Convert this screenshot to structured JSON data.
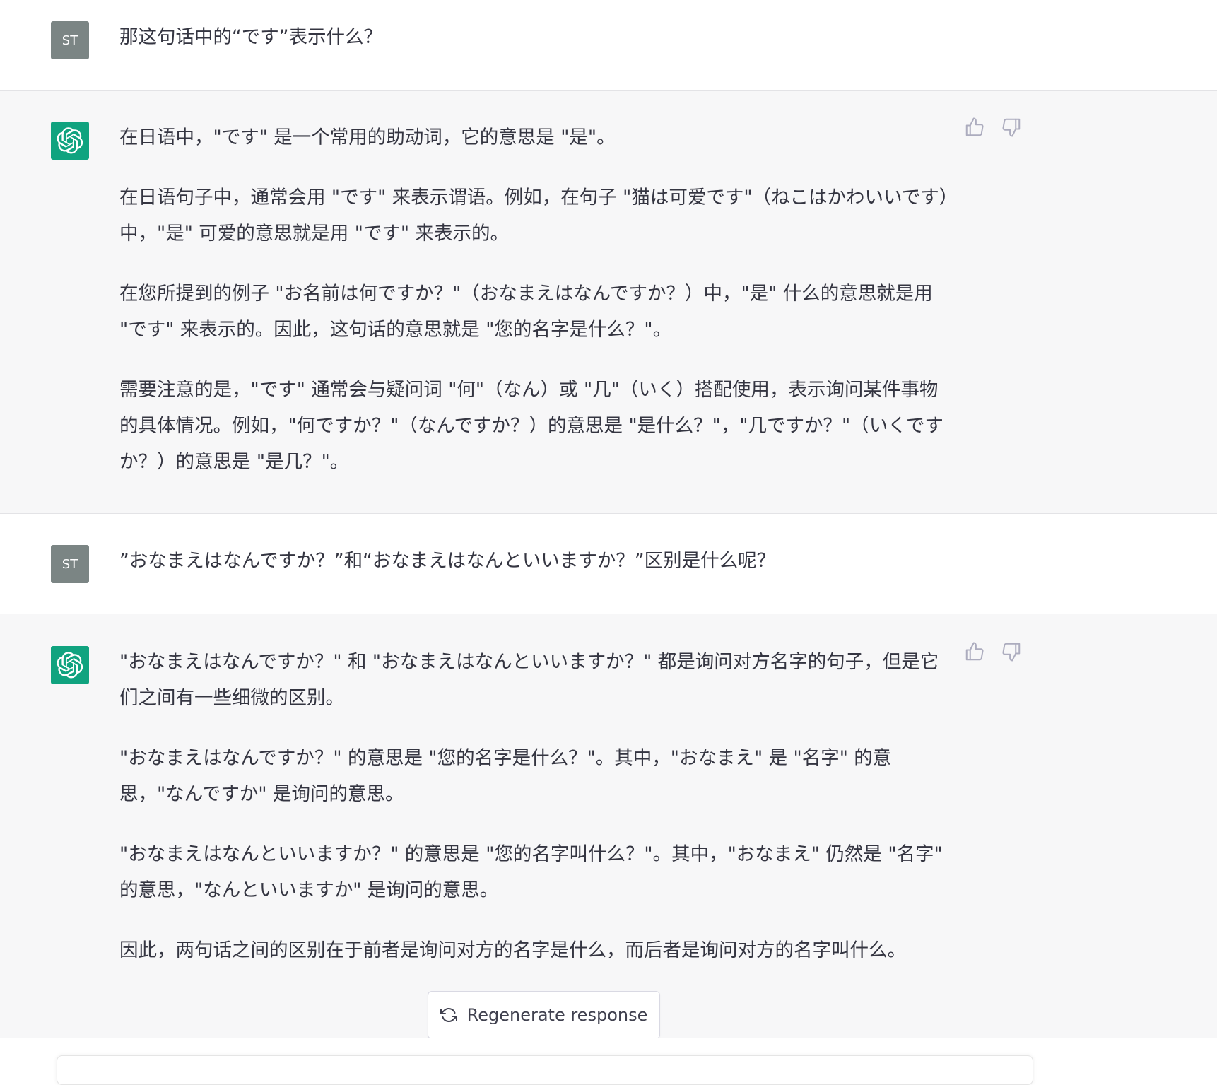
{
  "conversation": {
    "user_avatar_label": "ST",
    "messages": [
      {
        "role": "user",
        "text": "那这句话中的“です”表示什么？"
      },
      {
        "role": "assistant",
        "paragraphs": [
          "在日语中，\"です\" 是一个常用的助动词，它的意思是 \"是\"。",
          "在日语句子中，通常会用 \"です\" 来表示谓语。例如，在句子 \"猫は可爱です\"（ねこはかわいいです）中，\"是\" 可爱的意思就是用 \"です\" 来表示的。",
          "在您所提到的例子 \"お名前は何ですか？\"（おなまえはなんですか？）中，\"是\" 什么的意思就是用 \"です\" 来表示的。因此，这句话的意思就是 \"您的名字是什么？\"。",
          "需要注意的是，\"です\" 通常会与疑问词 \"何\"（なん）或 \"几\"（いく）搭配使用，表示询问某件事物的具体情况。例如，\"何ですか？\"（なんですか？）的意思是 \"是什么？\"，\"几ですか？\"（いくですか？）的意思是 \"是几？\"。"
        ]
      },
      {
        "role": "user",
        "text": "”おなまえはなんですか？”和“おなまえはなんといいますか？”区别是什么呢？"
      },
      {
        "role": "assistant",
        "paragraphs": [
          "\"おなまえはなんですか？\" 和 \"おなまえはなんといいますか？\" 都是询问对方名字的句子，但是它们之间有一些细微的区别。",
          "\"おなまえはなんですか？\" 的意思是 \"您的名字是什么？\"。其中，\"おなまえ\" 是 \"名字\" 的意思，\"なんですか\" 是询问的意思。",
          "\"おなまえはなんといいますか？\" 的意思是 \"您的名字叫什么？\"。其中，\"おなまえ\" 仍然是 \"名字\" 的意思，\"なんといいますか\" 是询问的意思。",
          "因此，两句话之间的区别在于前者是询问对方的名字是什么，而后者是询问对方的名字叫什么。"
        ]
      }
    ]
  },
  "regenerate": {
    "label": "Regenerate response",
    "icon": "refresh-icon"
  },
  "icons": {
    "assistant_avatar": "openai-logo-icon",
    "feedback_up": "thumbs-up-icon",
    "feedback_down": "thumbs-down-icon"
  },
  "colors": {
    "assistant_bg": "#f7f7f8",
    "user_avatar_bg": "#7b8584",
    "assistant_avatar_bg": "#10a37f",
    "text": "#343541",
    "icon": "#acacbe"
  }
}
